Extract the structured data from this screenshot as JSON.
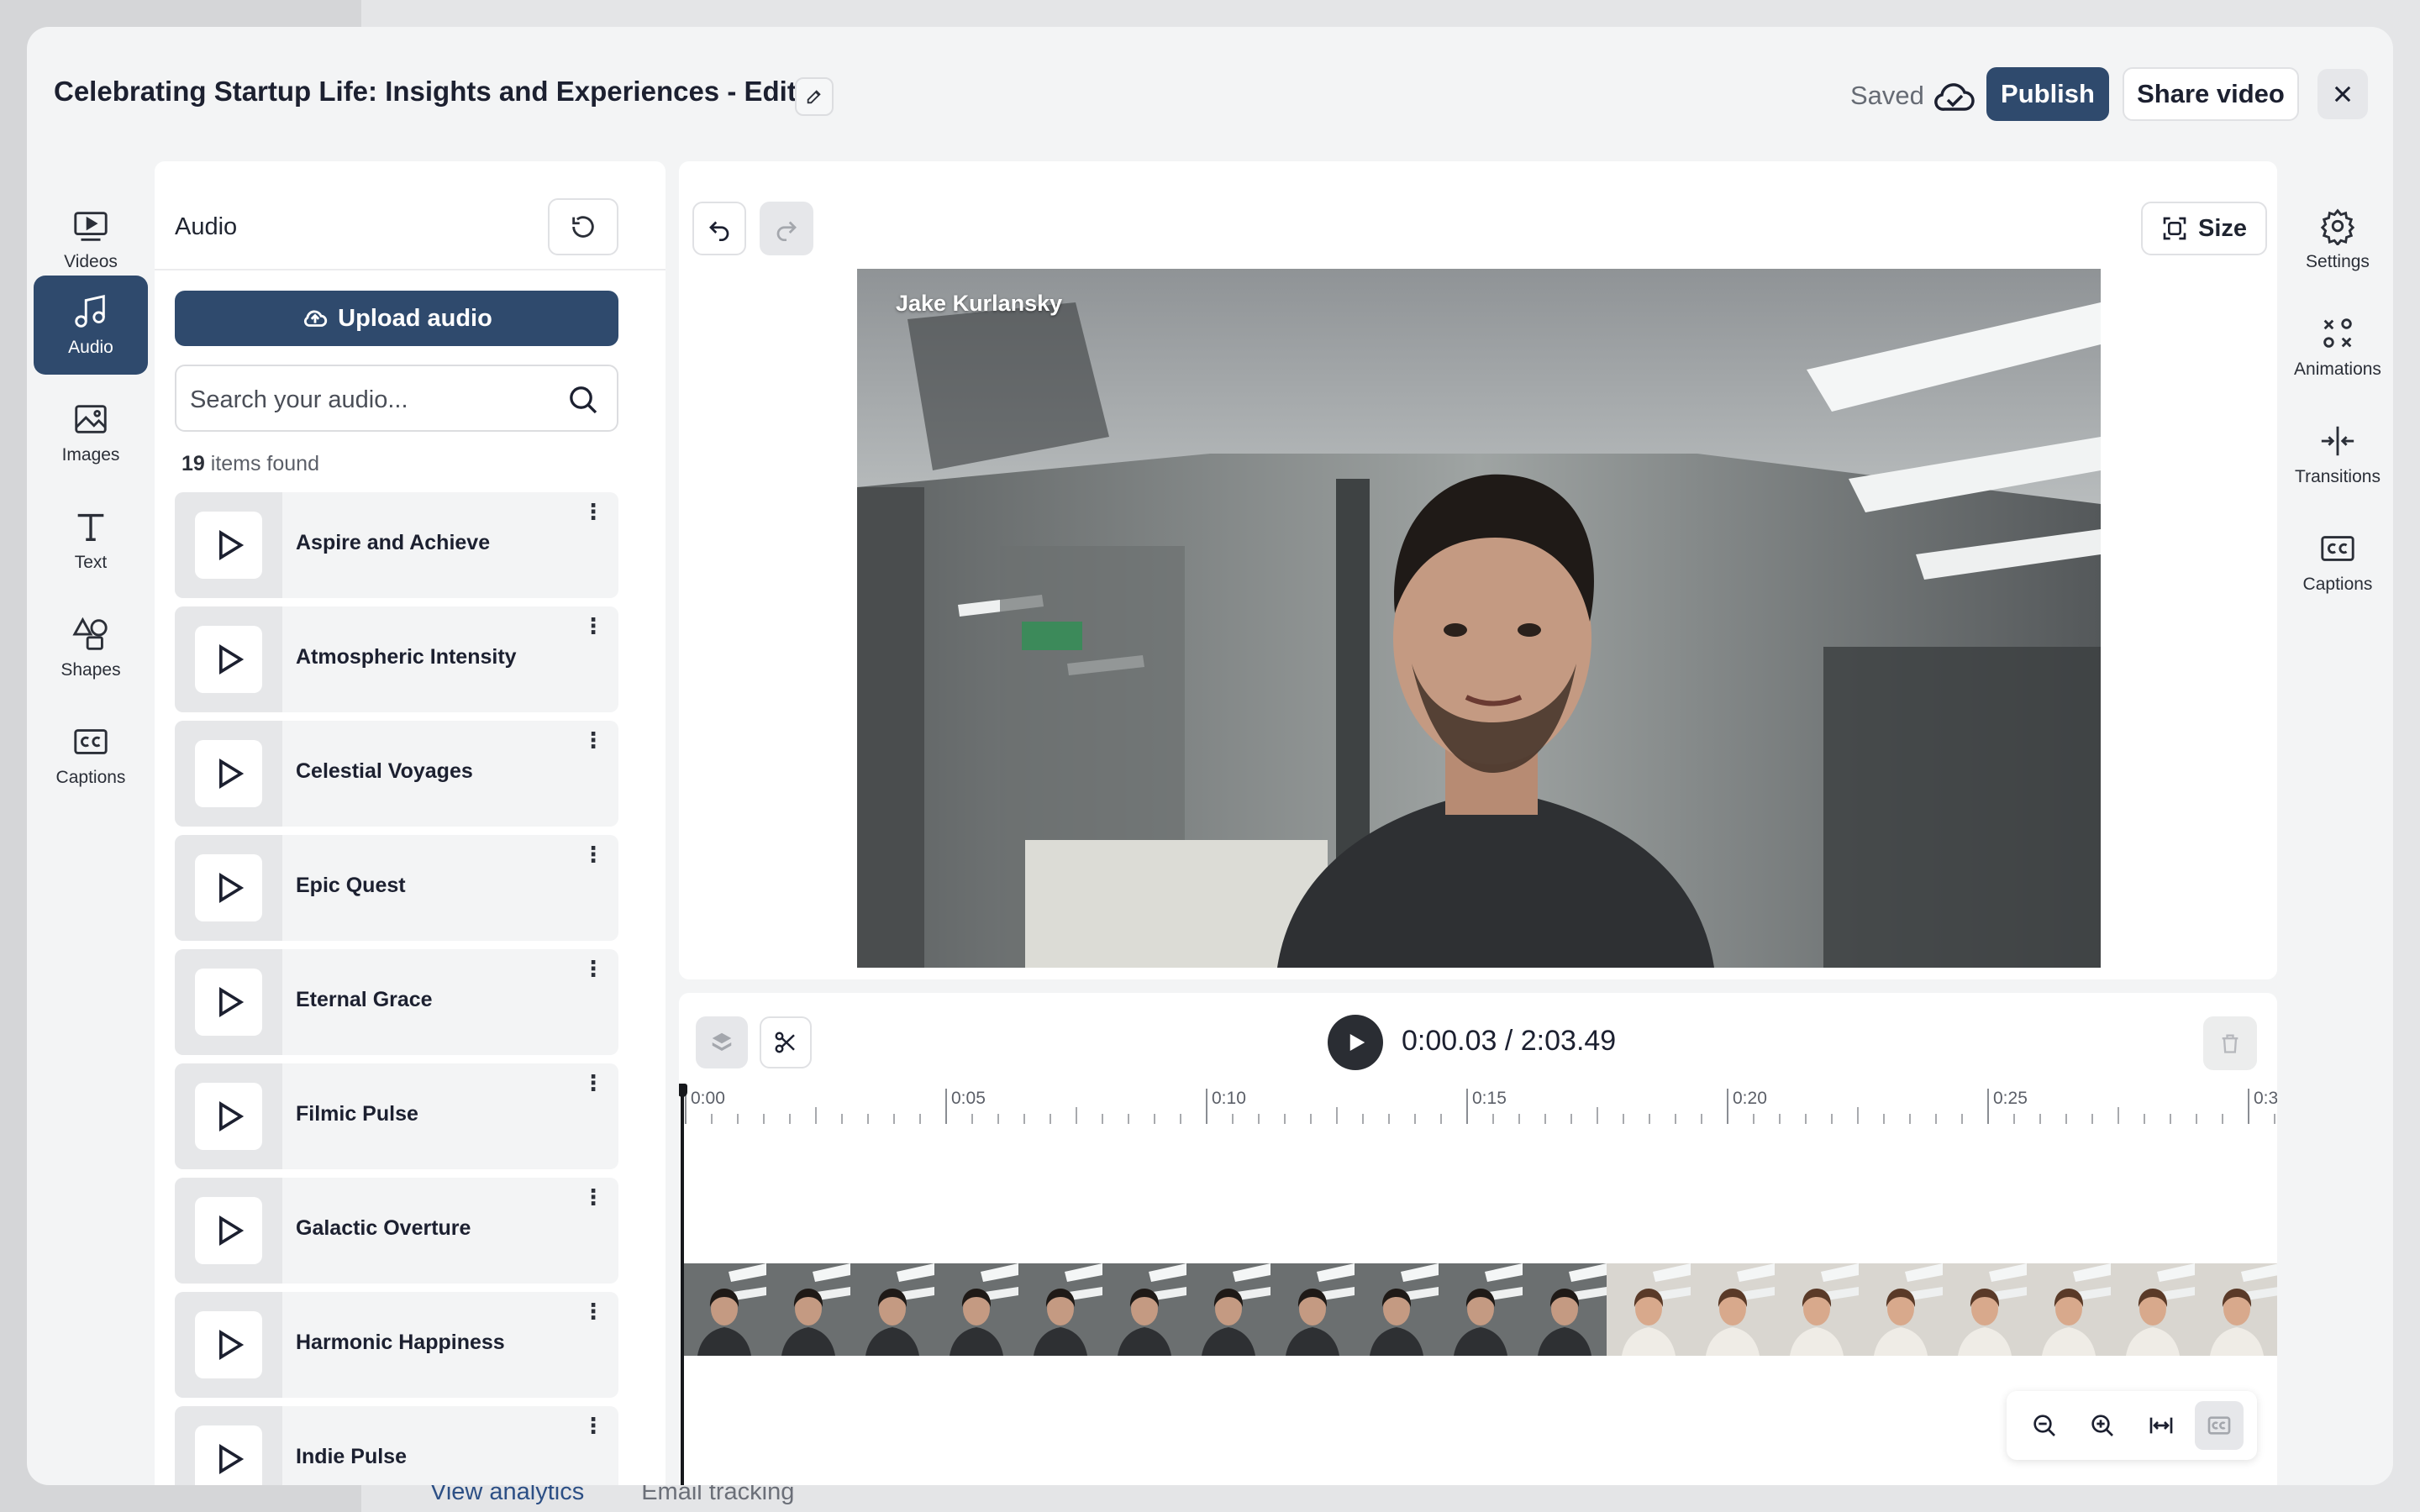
{
  "background": {
    "links": [
      "View analytics",
      "Email tracking"
    ]
  },
  "header": {
    "title": "Celebrating Startup Life: Insights and Experiences - Edit",
    "saved_label": "Saved",
    "publish_label": "Publish",
    "share_label": "Share video"
  },
  "left_nav": [
    {
      "label": "Videos",
      "icon": "video-play-icon"
    },
    {
      "label": "Audio",
      "icon": "music-note-icon",
      "active": true
    },
    {
      "label": "Images",
      "icon": "image-icon"
    },
    {
      "label": "Text",
      "icon": "text-t-icon"
    },
    {
      "label": "Shapes",
      "icon": "shapes-icon"
    },
    {
      "label": "Captions",
      "icon": "cc-icon"
    }
  ],
  "audio_panel": {
    "title": "Audio",
    "upload_label": "Upload audio",
    "search_placeholder": "Search your audio...",
    "count_number": "19",
    "count_suffix": " items found",
    "tracks": [
      "Aspire and Achieve",
      "Atmospheric Intensity",
      "Celestial Voyages",
      "Epic Quest",
      "Eternal Grace",
      "Filmic Pulse",
      "Galactic Overture",
      "Harmonic Happiness",
      "Indie Pulse"
    ]
  },
  "preview": {
    "size_label": "Size",
    "speaker_name": "Jake Kurlansky"
  },
  "timeline": {
    "time_display": "0:00.03 / 2:03.49",
    "ticks": [
      "0:00",
      "0:05",
      "0:10",
      "0:15",
      "0:20",
      "0:25",
      "0:3"
    ]
  },
  "right_nav": [
    {
      "label": "Settings",
      "icon": "gear-icon"
    },
    {
      "label": "Animations",
      "icon": "animation-icon"
    },
    {
      "label": "Transitions",
      "icon": "transition-icon"
    },
    {
      "label": "Captions",
      "icon": "cc-icon"
    }
  ],
  "colors": {
    "primary": "#2f4a6d",
    "link": "#2c4f85"
  }
}
